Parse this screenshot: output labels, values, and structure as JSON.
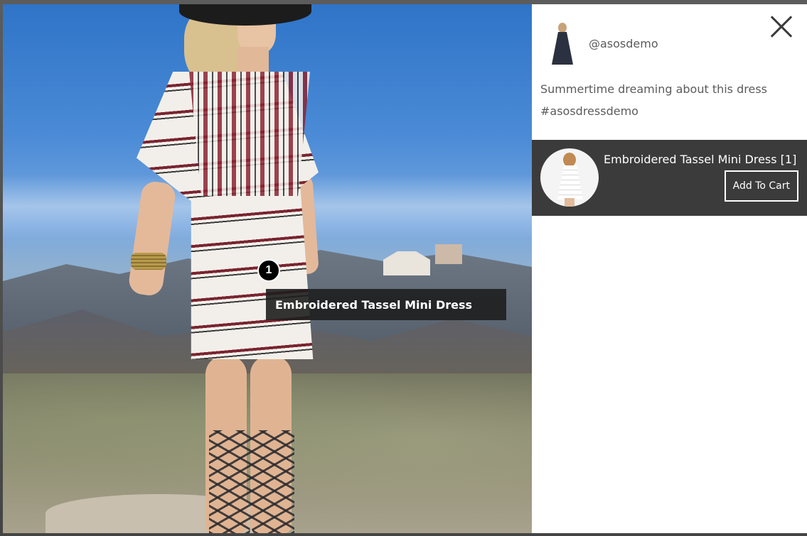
{
  "post": {
    "handle": "@asosdemo",
    "caption_line1": "Summertime dreaming about this dress",
    "caption_line2": "#asosdressdemo"
  },
  "hotspot": {
    "number": "1",
    "tooltip": "Embroidered Tassel Mini Dress"
  },
  "product": {
    "title": "Embroidered Tassel Mini Dress [1]",
    "button_label": "Add To Cart"
  },
  "colors": {
    "panel_dark": "#3b3b3b",
    "text_gray": "#5b5b5b",
    "hotspot_bg": "#000000"
  }
}
